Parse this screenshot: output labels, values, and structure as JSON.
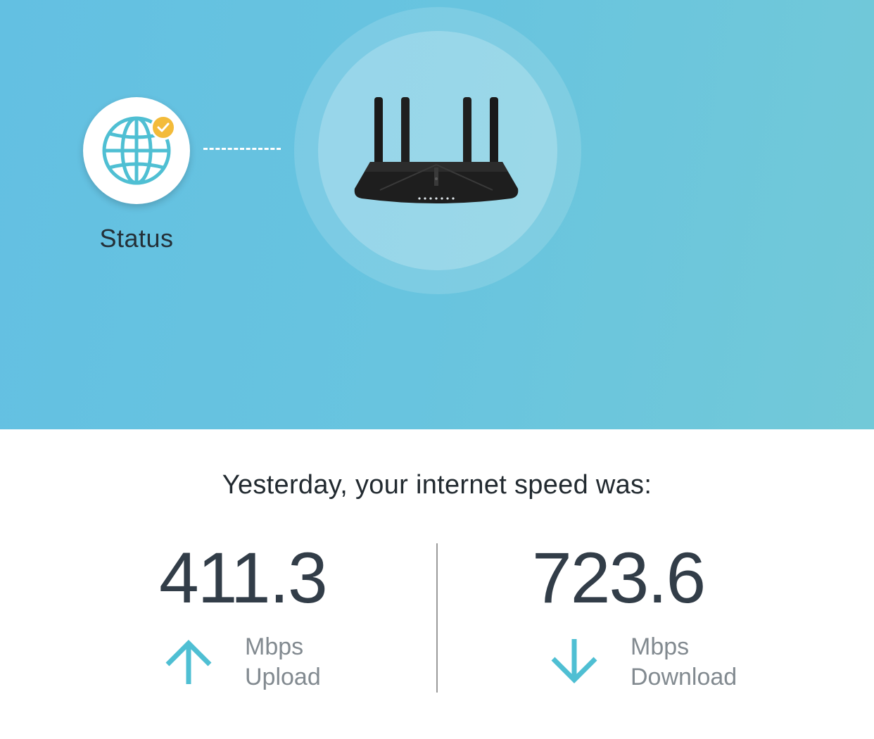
{
  "status_node": {
    "label": "Status",
    "icon": "globe-icon",
    "badge_icon": "check-icon",
    "badge_color": "#f3bb3a"
  },
  "device": {
    "icon": "router-icon"
  },
  "speed": {
    "headline": "Yesterday, your internet speed was:",
    "upload": {
      "value": "411.3",
      "unit": "Mbps",
      "label": "Upload",
      "icon": "arrow-up-icon"
    },
    "download": {
      "value": "723.6",
      "unit": "Mbps",
      "label": "Download",
      "icon": "arrow-down-icon"
    }
  },
  "colors": {
    "accent": "#4fbfd3",
    "hero_background": "#66c3e0",
    "text_dark": "#323d48",
    "text_muted": "#828a90"
  }
}
